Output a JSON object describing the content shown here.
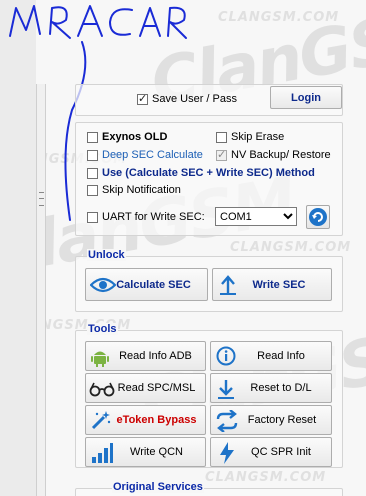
{
  "watermark": {
    "brand_big": "ClanGSM",
    "brand_small": "CLANGSM.COM"
  },
  "handwriting": "MRACAR",
  "save_group": {
    "save_checkbox": "Save User / Pass",
    "login_button": "Login"
  },
  "options": {
    "exynos_old": "Exynos OLD",
    "skip_erase": "Skip Erase",
    "deep_sec": "Deep SEC Calculate",
    "nv_backup": "NV Backup/ Restore",
    "use_method": "Use (Calculate SEC + Write SEC) Method",
    "skip_notification": "Skip Notification",
    "uart_label": "UART for Write SEC:",
    "com_port": "COM1"
  },
  "unlock": {
    "title": "Unlock",
    "calculate": "Calculate SEC",
    "write": "Write SEC"
  },
  "tools": {
    "title": "Tools",
    "read_info_adb": "Read Info ADB",
    "read_info": "Read Info",
    "read_spc": "Read SPC/MSL",
    "reset_dl": "Reset to D/L",
    "etoken": "eToken Bypass",
    "factory_reset": "Factory Reset",
    "write_qcn": "Write QCN",
    "qc_spr": "QC SPR Init"
  },
  "next_group_title": "Original Services",
  "colors": {
    "title_blue": "#0c2aa8",
    "link_blue": "#1c5fb5",
    "red": "#cc0000",
    "android_green": "#7cb342",
    "icon_blue": "#1e73c8"
  }
}
